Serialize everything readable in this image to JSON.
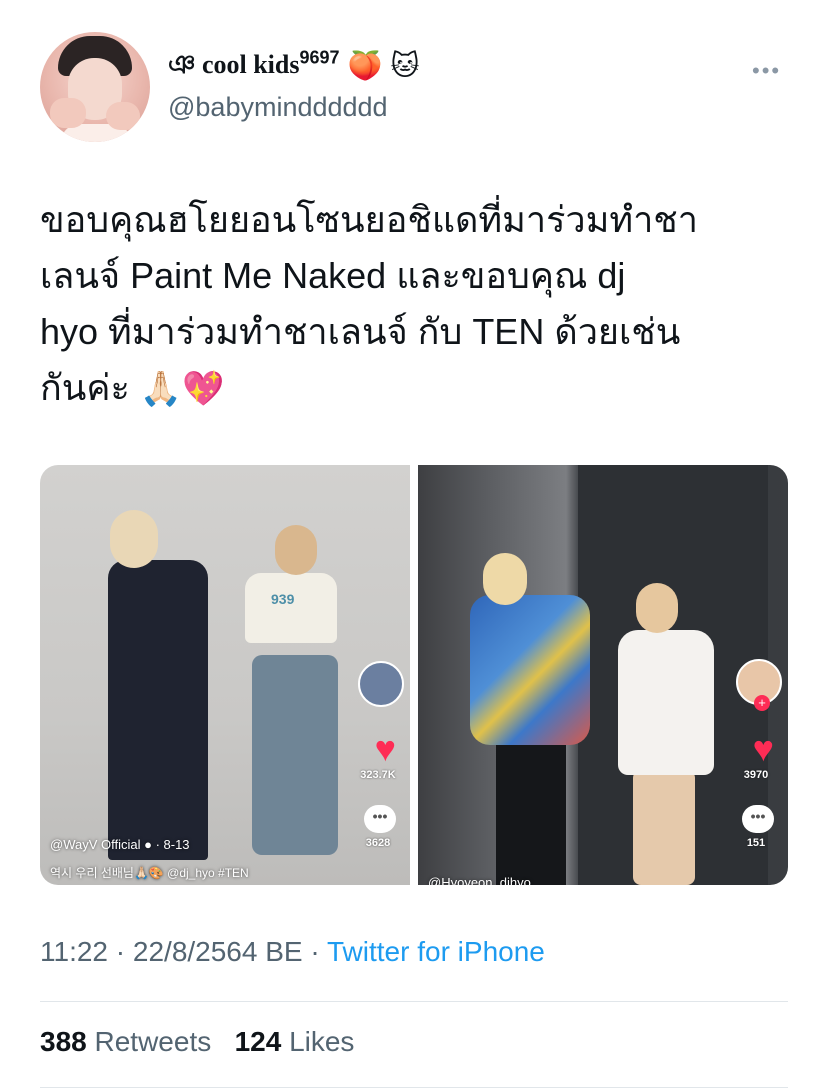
{
  "author": {
    "display_name": "ঞ cool kids",
    "superscript": "9697",
    "emojis": [
      "🍑",
      "🐱"
    ],
    "handle": "@babymindddddd"
  },
  "more_label": "•••",
  "tweet": {
    "text_lines": [
      "ขอบคุณฮโยยอนโซนยอชิแดที่มาร่วมทำชา",
      "เลนจ์ Paint Me Naked และขอบคุณ dj",
      "hyo ที่มาร่วมทำชาเลนจ์ กับ TEN ด้วยเช่น",
      "กันค่ะ"
    ],
    "trailing_emojis": "🙏🏻💖"
  },
  "media": {
    "panel1": {
      "shirt_text": "939",
      "likes": "323.7K",
      "comments": "3628",
      "comment_icon": "•••",
      "user": "@WayV Official ● · 8-13",
      "caption": "역시 우리 선배님🙏🏻🎨 @dj_hyo #TEN"
    },
    "panel2": {
      "likes": "3970",
      "comments": "151",
      "comment_icon": "•••",
      "plus": "+",
      "user": "@Hyoyeon_djhyo"
    }
  },
  "meta": {
    "time": "11:22",
    "sep": " · ",
    "date": "22/8/2564 BE",
    "sep2": " · ",
    "source": "Twitter for iPhone"
  },
  "stats": {
    "retweets_count": "388",
    "retweets_label": "Retweets",
    "likes_count": "124",
    "likes_label": "Likes"
  },
  "colors": {
    "link": "#1d9bf0",
    "secondary_text": "#536471",
    "tiktok_red": "#fe2c55"
  }
}
